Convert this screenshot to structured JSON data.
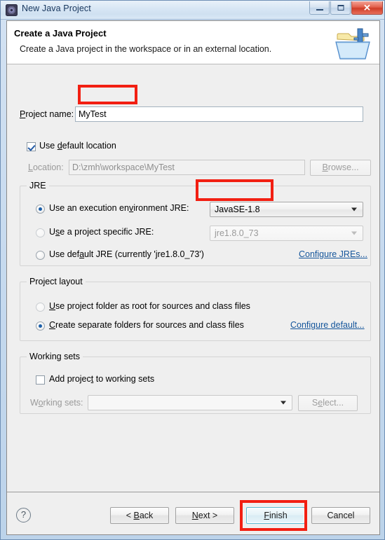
{
  "window": {
    "title": "New Java Project",
    "icon": "eclipse-gear-icon",
    "controls": {
      "minimize": "minimize-button",
      "maximize": "maximize-button",
      "close": "close-button",
      "close_glyph": "✕"
    }
  },
  "header": {
    "title": "Create a Java Project",
    "subtitle": "Create a Java project in the workspace or in an external location.",
    "banner_icon": "java-project-folder-icon"
  },
  "project_name": {
    "label": "Project name:",
    "value": "MyTest",
    "placeholder": ""
  },
  "location": {
    "use_default_label": "Use default location",
    "use_default_checked": true,
    "label": "Location:",
    "value": "D:\\zmh\\workspace\\MyTest",
    "browse_label": "Browse...",
    "browse_enabled": false
  },
  "jre": {
    "group_title": "JRE",
    "options": [
      {
        "label": "Use an execution environment JRE:",
        "selected": true,
        "value": "JavaSE-1.8",
        "control": "combobox",
        "enabled": true
      },
      {
        "label": "Use a project specific JRE:",
        "selected": false,
        "value": "jre1.8.0_73",
        "control": "combobox",
        "enabled": false
      },
      {
        "label": "Use default JRE (currently 'jre1.8.0_73')",
        "selected": false,
        "value": "",
        "control": "none",
        "enabled": true
      }
    ],
    "configure_link": "Configure JREs..."
  },
  "project_layout": {
    "group_title": "Project layout",
    "options": [
      {
        "label": "Use project folder as root for sources and class files",
        "selected": false
      },
      {
        "label": "Create separate folders for sources and class files",
        "selected": true
      }
    ],
    "configure_link": "Configure default..."
  },
  "working_sets": {
    "group_title": "Working sets",
    "add_label": "Add project to working sets",
    "add_checked": false,
    "label": "Working sets:",
    "value": "",
    "select_label": "Select...",
    "select_enabled": false
  },
  "footer": {
    "help_icon": "?",
    "buttons": [
      {
        "label": "< Back",
        "default": false,
        "enabled": true
      },
      {
        "label": "Next >",
        "default": false,
        "enabled": true
      },
      {
        "label": "Finish",
        "default": true,
        "enabled": true
      },
      {
        "label": "Cancel",
        "default": false,
        "enabled": true
      }
    ]
  },
  "annotations": {
    "color": "#f21f12",
    "targets": [
      "project-name-input",
      "jre-execution-environment-combo",
      "finish-button"
    ]
  }
}
